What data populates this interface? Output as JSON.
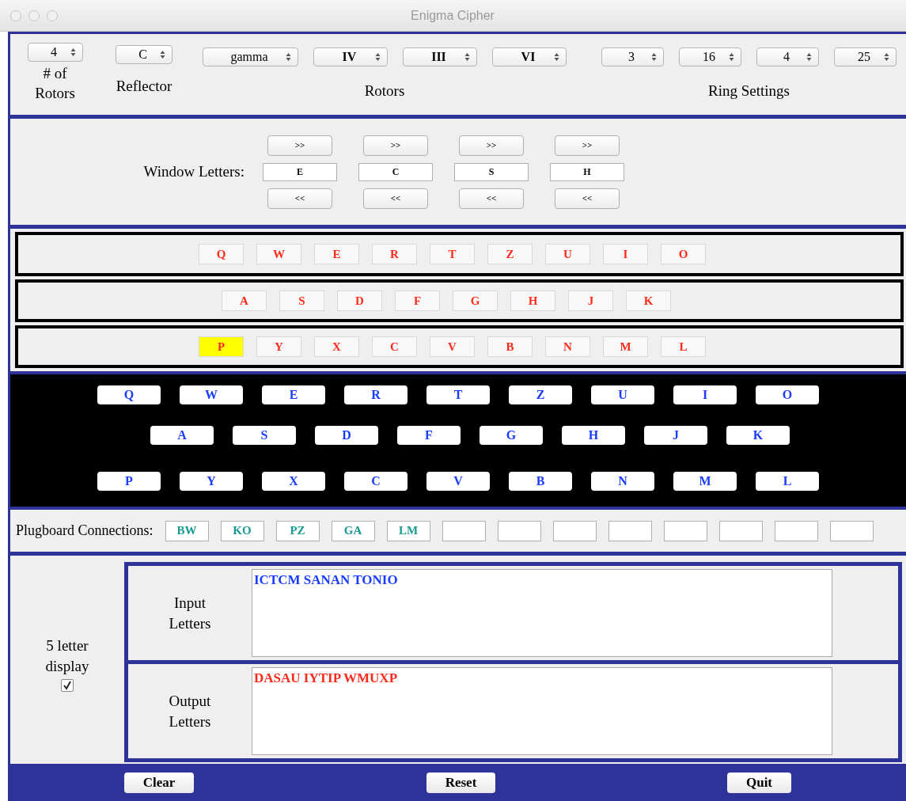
{
  "window": {
    "title": "Enigma Cipher"
  },
  "settings": {
    "rotor_count": {
      "value": "4",
      "label": "# of Rotors"
    },
    "reflector": {
      "value": "C",
      "label": "Reflector"
    },
    "rotors": [
      {
        "value": "gamma",
        "kind": "thin"
      },
      {
        "value": "IV",
        "kind": "main"
      },
      {
        "value": "III",
        "kind": "main"
      },
      {
        "value": "VI",
        "kind": "main"
      }
    ],
    "rotors_label": "Rotors",
    "ring_settings": [
      "3",
      "16",
      "4",
      "25"
    ],
    "ring_label": "Ring Settings"
  },
  "window_letters": {
    "label": "Window Letters:",
    "columns": [
      {
        "up": ">>",
        "letter": "E",
        "down": "<<"
      },
      {
        "up": ">>",
        "letter": "C",
        "down": "<<"
      },
      {
        "up": ">>",
        "letter": "S",
        "down": "<<"
      },
      {
        "up": ">>",
        "letter": "H",
        "down": "<<"
      }
    ]
  },
  "lampboard": [
    [
      {
        "letter": "Q",
        "lit": false
      },
      {
        "letter": "W",
        "lit": false
      },
      {
        "letter": "E",
        "lit": false
      },
      {
        "letter": "R",
        "lit": false
      },
      {
        "letter": "T",
        "lit": false
      },
      {
        "letter": "Z",
        "lit": false
      },
      {
        "letter": "U",
        "lit": false
      },
      {
        "letter": "I",
        "lit": false
      },
      {
        "letter": "O",
        "lit": false
      }
    ],
    [
      {
        "letter": "A",
        "lit": false
      },
      {
        "letter": "S",
        "lit": false
      },
      {
        "letter": "D",
        "lit": false
      },
      {
        "letter": "F",
        "lit": false
      },
      {
        "letter": "G",
        "lit": false
      },
      {
        "letter": "H",
        "lit": false
      },
      {
        "letter": "J",
        "lit": false
      },
      {
        "letter": "K",
        "lit": false
      }
    ],
    [
      {
        "letter": "P",
        "lit": true
      },
      {
        "letter": "Y",
        "lit": false
      },
      {
        "letter": "X",
        "lit": false
      },
      {
        "letter": "C",
        "lit": false
      },
      {
        "letter": "V",
        "lit": false
      },
      {
        "letter": "B",
        "lit": false
      },
      {
        "letter": "N",
        "lit": false
      },
      {
        "letter": "M",
        "lit": false
      },
      {
        "letter": "L",
        "lit": false
      }
    ]
  ],
  "keyboard": [
    [
      "Q",
      "W",
      "E",
      "R",
      "T",
      "Z",
      "U",
      "I",
      "O"
    ],
    [
      "A",
      "S",
      "D",
      "F",
      "G",
      "H",
      "J",
      "K"
    ],
    [
      "P",
      "Y",
      "X",
      "C",
      "V",
      "B",
      "N",
      "M",
      "L"
    ]
  ],
  "plugboard": {
    "label": "Plugboard Connections:",
    "slots": [
      {
        "kind": "pair",
        "value": "BW"
      },
      {
        "kind": "pair",
        "value": "KO"
      },
      {
        "kind": "pair",
        "value": "PZ"
      },
      {
        "kind": "pair",
        "value": "GA"
      },
      {
        "kind": "pair",
        "value": "LM"
      },
      {
        "kind": "empty"
      },
      {
        "kind": "empty"
      },
      {
        "kind": "empty"
      },
      {
        "kind": "empty"
      },
      {
        "kind": "empty"
      },
      {
        "kind": "empty"
      },
      {
        "kind": "empty"
      },
      {
        "kind": "empty"
      }
    ]
  },
  "display_option": {
    "label": "5 letter display",
    "checked": true
  },
  "input": {
    "label": "Input Letters",
    "text": "ICTCM SANAN TONIO"
  },
  "output": {
    "label": "Output Letters",
    "text": "DASAU IYTIP WMUXP"
  },
  "buttons": [
    "Clear",
    "Reset",
    "Quit"
  ]
}
